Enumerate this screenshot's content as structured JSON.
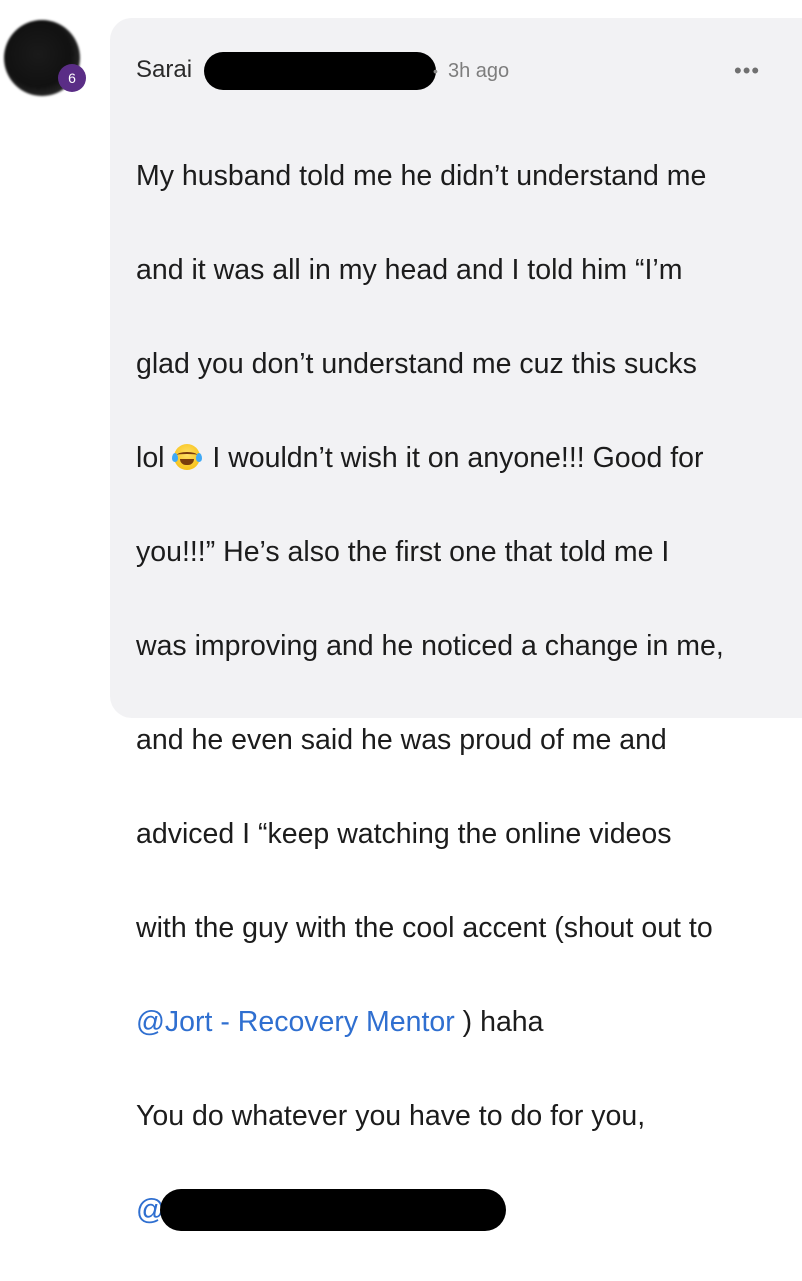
{
  "comment": {
    "author": "Sarai",
    "badge_count": "6",
    "time_separator": "•",
    "timestamp": "3h ago",
    "more_menu": "•••",
    "lines": [
      "My husband told me he didn’t understand me",
      "and it was all in my head and I told him “I’m",
      "glad you don’t understand me cuz this sucks"
    ],
    "line4_before_emoji": "lol",
    "line4_after_emoji": " I wouldn’t wish it on anyone!!! Good for",
    "lines_b": [
      "you!!!” He’s also the first one that told me I",
      "was improving and he noticed a change in me,",
      "and he even said he was proud of me and",
      "adviced I “keep watching the online videos",
      "with the guy with the cool accent (shout out to"
    ],
    "mention_1": "@Jort - Recovery Mentor",
    "after_mention_1": " ) haha",
    "line_last": "You do whatever you have to do for you,",
    "mention_2_prefix": "@",
    "emoji_icon": "face-with-tears-of-joy-icon"
  },
  "colors": {
    "card_bg": "#f2f2f4",
    "mention": "#2f6fd0",
    "badge": "#5a2d86"
  }
}
